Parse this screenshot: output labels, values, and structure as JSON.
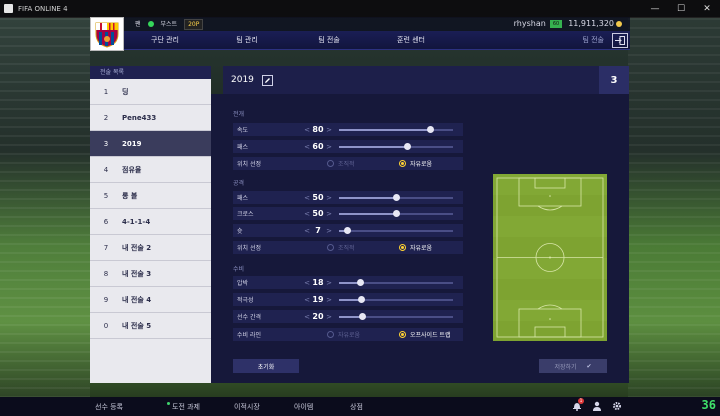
{
  "window": {
    "title": "FIFA ONLINE 4",
    "minimize": "—",
    "maximize": "☐",
    "close": "✕"
  },
  "top_strip": {
    "tag1": "팬",
    "tag2": "부스트",
    "tag3": "20P",
    "username": "rhyshan",
    "level": "60",
    "coins": "11,911,320"
  },
  "nav": {
    "items": [
      "구단 관리",
      "팀 관리",
      "팀 전술",
      "훈련 센터"
    ],
    "current": "팀 전술"
  },
  "tactic_list": {
    "header": "전술 목록",
    "items": [
      {
        "num": "1",
        "name": "딩"
      },
      {
        "num": "2",
        "name": "Pene433"
      },
      {
        "num": "3",
        "name": "2019"
      },
      {
        "num": "4",
        "name": "점유율"
      },
      {
        "num": "5",
        "name": "롱 볼"
      },
      {
        "num": "6",
        "name": "4-1-1-4"
      },
      {
        "num": "7",
        "name": "내 전술 2"
      },
      {
        "num": "8",
        "name": "내 전술 3"
      },
      {
        "num": "9",
        "name": "내 전술 4"
      },
      {
        "num": "0",
        "name": "내 전술 5"
      }
    ],
    "selected_index": 2
  },
  "panel": {
    "name": "2019",
    "slot": "3",
    "sections": {
      "build": "전개",
      "attack": "공격",
      "defense": "수비"
    },
    "build": {
      "speed": {
        "label": "속도",
        "value": "80",
        "level": 0.8
      },
      "passing": {
        "label": "패스",
        "value": "60",
        "level": 0.6
      },
      "positioning": {
        "label": "위치 선정",
        "opt1": "조직적",
        "opt2": "자유로움",
        "selected": 2
      }
    },
    "attack": {
      "passing": {
        "label": "패스",
        "value": "50",
        "level": 0.5
      },
      "crossing": {
        "label": "크로스",
        "value": "50",
        "level": 0.5
      },
      "shooting": {
        "label": "슛",
        "value": "7",
        "level": 0.07
      },
      "positioning": {
        "label": "위치 선정",
        "opt1": "조직적",
        "opt2": "자유로움",
        "selected": 2
      }
    },
    "defense": {
      "pressure": {
        "label": "압박",
        "value": "18",
        "level": 0.18
      },
      "aggression": {
        "label": "적극성",
        "value": "19",
        "level": 0.19
      },
      "width": {
        "label": "선수 간격",
        "value": "20",
        "level": 0.2
      },
      "line": {
        "label": "수비 라인",
        "opt1": "자유로움",
        "opt2": "오프사이드 트랩",
        "selected": 2
      }
    },
    "reset_label": "초기화",
    "save_label": "저장하기",
    "save_check": "✔"
  },
  "bottom_bar": {
    "items": [
      "선수 등록",
      "도전 과제",
      "이적시장",
      "아이템",
      "상점"
    ],
    "notification_count": "1",
    "fps": "36"
  },
  "colors": {
    "accent": "#ffd233",
    "nav_bg": "#1a1e55",
    "panel_bg": "#16183a",
    "pitch": "#7ea331"
  }
}
